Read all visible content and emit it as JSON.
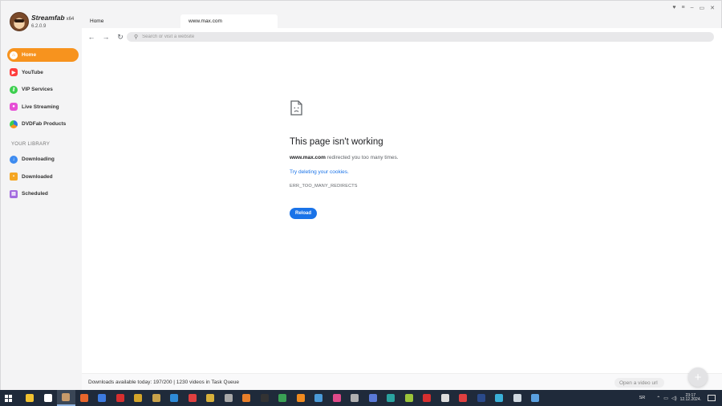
{
  "app": {
    "name": "Streamfab",
    "arch": "x64",
    "version": "6.2.0.9"
  },
  "sidebar": {
    "items": [
      {
        "label": "Home",
        "icon": "home-icon",
        "color": "#f7931e"
      },
      {
        "label": "YouTube",
        "icon": "youtube-icon",
        "color": "#ff3d3d"
      },
      {
        "label": "VIP Services",
        "icon": "key-icon",
        "color": "#3ccf4e"
      },
      {
        "label": "Live Streaming",
        "icon": "camera-icon",
        "color": "#e64fd6"
      },
      {
        "label": "DVDFab Products",
        "icon": "dvdfab-icon",
        "color": "#2d7be0"
      }
    ],
    "library_title": "YOUR LIBRARY",
    "library_items": [
      {
        "label": "Downloading",
        "icon": "download-icon",
        "color": "#3d8bf0"
      },
      {
        "label": "Downloaded",
        "icon": "folder-icon",
        "color": "#f5a623"
      },
      {
        "label": "Scheduled",
        "icon": "calendar-icon",
        "color": "#a36bdf"
      }
    ]
  },
  "tabs": [
    {
      "label": "Home",
      "active": false
    },
    {
      "label": "www.max.com",
      "active": true
    }
  ],
  "navbar": {
    "search_placeholder": "Search or visit a website"
  },
  "error": {
    "title": "This page isn't working",
    "host": "www.max.com",
    "message": " redirected you too many times.",
    "link": "Try deleting your cookies.",
    "code": "ERR_TOO_MANY_REDIRECTS",
    "button": "Reload"
  },
  "status": {
    "text": "Downloads available today: 197/200 | 1230 videos in Task Queue",
    "open_video_placeholder": "Open a video url"
  },
  "taskbar": {
    "apps": [
      {
        "name": "file-explorer-icon",
        "color": "#f2c230",
        "open": false
      },
      {
        "name": "yandex-browser-icon",
        "color": "#ffffff",
        "open": false
      },
      {
        "name": "streamfab-icon",
        "color": "#c89b6a",
        "open": true
      },
      {
        "name": "firefox-icon",
        "color": "#e8662c",
        "open": false
      },
      {
        "name": "downloader-icon",
        "color": "#3d7be0",
        "open": false
      },
      {
        "name": "game-icon",
        "color": "#d62f2f",
        "open": false
      },
      {
        "name": "chrome-icon",
        "color": "#d4a52a",
        "open": false
      },
      {
        "name": "settings-icon",
        "color": "#c9a24a",
        "open": false
      },
      {
        "name": "app-icon-blue",
        "color": "#2e8bd8",
        "open": false
      },
      {
        "name": "app-icon-red",
        "color": "#e04040",
        "open": false
      },
      {
        "name": "app-icon-gold",
        "color": "#d7b03a",
        "open": false
      },
      {
        "name": "app-icon-gray",
        "color": "#a8a8a8",
        "open": false
      },
      {
        "name": "app-icon-orange",
        "color": "#e87f2a",
        "open": false
      },
      {
        "name": "media-player-icon",
        "color": "#333333",
        "open": false
      },
      {
        "name": "app-icon-green",
        "color": "#3aa055",
        "open": false
      },
      {
        "name": "vlc-icon",
        "color": "#f08a1f",
        "open": false
      },
      {
        "name": "image-viewer-icon",
        "color": "#4a9ad8",
        "open": false
      },
      {
        "name": "app-icon-pink",
        "color": "#e04a8a",
        "open": false
      },
      {
        "name": "disc-icon",
        "color": "#b0b0b0",
        "open": false
      },
      {
        "name": "save-icon",
        "color": "#5a7ad8",
        "open": false
      },
      {
        "name": "app-icon-teal",
        "color": "#2aa3a0",
        "open": false
      },
      {
        "name": "android-icon",
        "color": "#9bc43a",
        "open": false
      },
      {
        "name": "record-icon",
        "color": "#d62f2f",
        "open": false
      },
      {
        "name": "sm-icon",
        "color": "#dddddd",
        "open": false
      },
      {
        "name": "se-icon",
        "color": "#e04040",
        "open": false
      },
      {
        "name": "app-icon-navy",
        "color": "#2a4a8a",
        "open": false
      },
      {
        "name": "chat-icon",
        "color": "#3ab0d8",
        "open": false
      },
      {
        "name": "steam-icon",
        "color": "#cfd8e0",
        "open": false
      },
      {
        "name": "maps-icon",
        "color": "#5aa0e0",
        "open": false
      }
    ],
    "lang": "SR",
    "time": "23:17",
    "date": "12.12.2024."
  }
}
